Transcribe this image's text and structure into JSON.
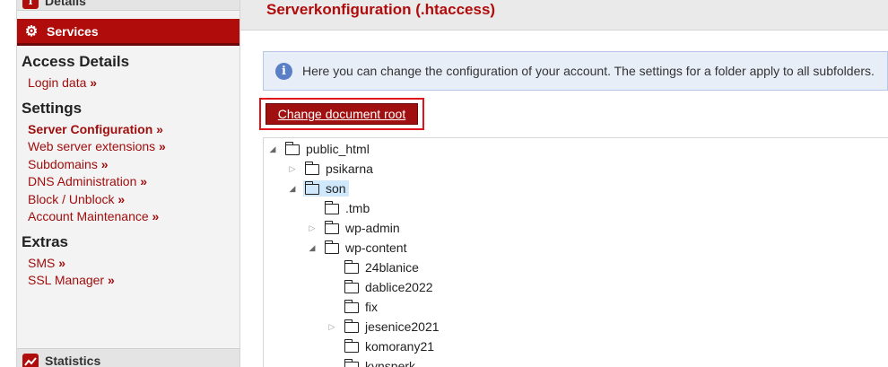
{
  "sidebar": {
    "details_label": "Details",
    "services_label": "Services",
    "statistics_label": "Statistics",
    "sections": [
      {
        "title": "Access Details",
        "links": [
          {
            "label": "Login data"
          }
        ]
      },
      {
        "title": "Settings",
        "links": [
          {
            "label": "Server Configuration",
            "active": true
          },
          {
            "label": "Web server extensions"
          },
          {
            "label": "Subdomains"
          },
          {
            "label": "DNS Administration"
          },
          {
            "label": "Block / Unblock"
          },
          {
            "label": "Account Maintenance"
          }
        ]
      },
      {
        "title": "Extras",
        "links": [
          {
            "label": "SMS"
          },
          {
            "label": "SSL Manager"
          }
        ]
      }
    ],
    "link_suffix": "»"
  },
  "main": {
    "title": "Serverkonfiguration (.htaccess)",
    "info_text": "Here you can change the configuration of your account. The settings for a folder apply to all subfolders.",
    "button_label": "Change document root"
  },
  "tree": [
    {
      "label": "public_html",
      "depth": 0,
      "toggle": "expanded"
    },
    {
      "label": "psikarna",
      "depth": 1,
      "toggle": "collapsed"
    },
    {
      "label": "son",
      "depth": 1,
      "toggle": "expanded",
      "selected": true
    },
    {
      "label": ".tmb",
      "depth": 2,
      "toggle": "none"
    },
    {
      "label": "wp-admin",
      "depth": 2,
      "toggle": "collapsed"
    },
    {
      "label": "wp-content",
      "depth": 2,
      "toggle": "expanded"
    },
    {
      "label": "24blanice",
      "depth": 3,
      "toggle": "none"
    },
    {
      "label": "dablice2022",
      "depth": 3,
      "toggle": "none"
    },
    {
      "label": "fix",
      "depth": 3,
      "toggle": "none"
    },
    {
      "label": "jesenice2021",
      "depth": 3,
      "toggle": "collapsed"
    },
    {
      "label": "komorany21",
      "depth": 3,
      "toggle": "none"
    },
    {
      "label": "kynsperk",
      "depth": 3,
      "toggle": "none"
    }
  ],
  "colors": {
    "brand": "#b10c0c",
    "info_bg": "#e8eef8",
    "selected_bg": "#cfe8fc"
  }
}
